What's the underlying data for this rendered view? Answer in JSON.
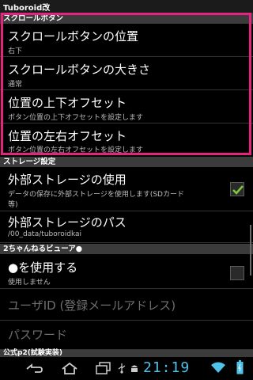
{
  "window": {
    "title": "Tuboroid改"
  },
  "sections": {
    "scroll_button": "スクロールボタン",
    "storage": "ストレージ設定",
    "viewer": "2ちゃんねるビューア●",
    "p2": "公式p2(試験実装)"
  },
  "items": [
    {
      "title": "スクロールボタンの位置",
      "summary": "右下"
    },
    {
      "title": "スクロールボタンの大きさ",
      "summary": "通常"
    },
    {
      "title": "位置の上下オフセット",
      "summary": "ボタン位置の上下オフセットを設定します"
    },
    {
      "title": "位置の左右オフセット",
      "summary": "ボタン位置の左右オフセットを設定します"
    },
    {
      "title": "外部ストレージの使用",
      "summary_line1": "データの保存に外部ストレージを使用します(SDカード",
      "summary_line2": "等)",
      "checked": true
    },
    {
      "title": "外部ストレージのパス",
      "summary": "/00_data/tuboroidkai"
    },
    {
      "title": "●を使用する",
      "summary": "使用しません",
      "checked": false
    },
    {
      "title": "ユーザID (登録メールアドレス)"
    },
    {
      "title": "パスワード"
    }
  ],
  "statusbar": {
    "time": "21:19"
  },
  "icons": [
    "back-icon",
    "home-icon",
    "recent-apps-icon",
    "usb-icon",
    "android-debug-icon",
    "wifi-icon",
    "battery-icon"
  ],
  "colors": {
    "highlight": "#e6247f",
    "check": "#7ec83a",
    "clock": "#4fc3e8"
  }
}
